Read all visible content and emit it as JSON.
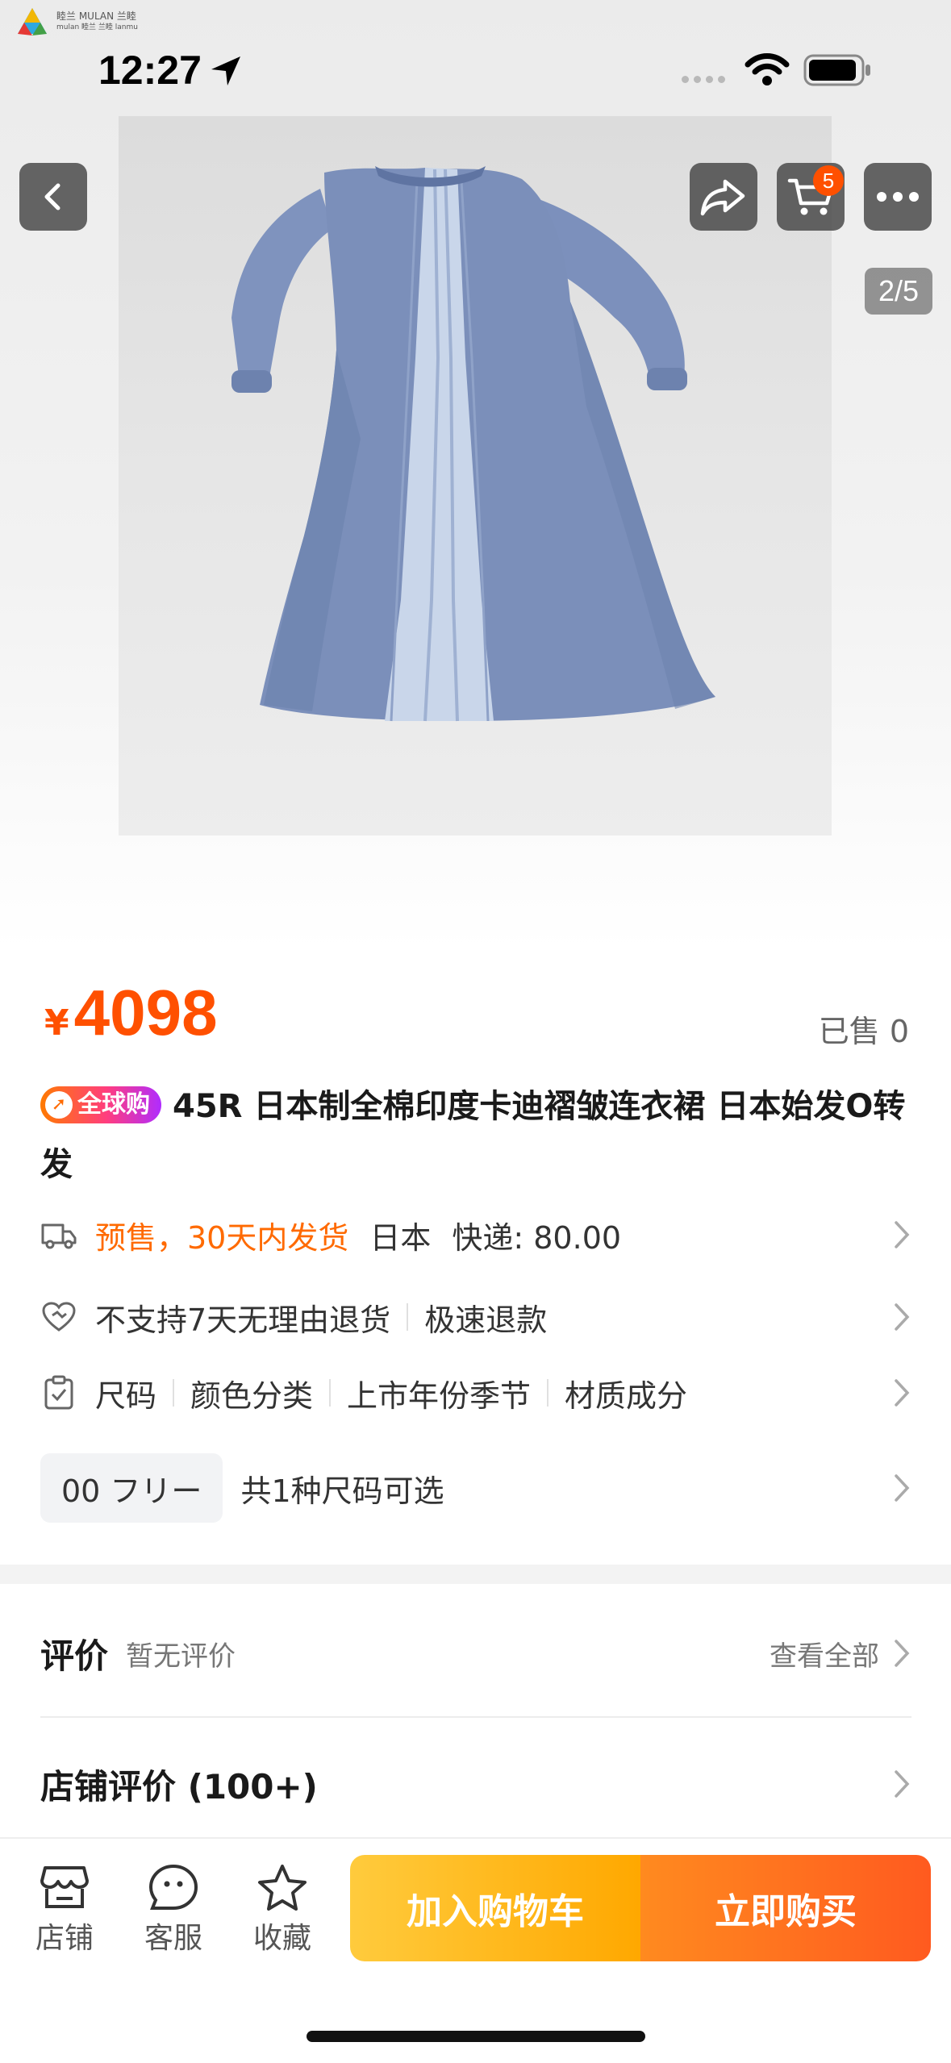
{
  "watermark": {
    "text_line1": "睦兰 MULAN 兰睦",
    "text_line2": "mulan 睦兰 兰睦 lanmu"
  },
  "status": {
    "time": "12:27"
  },
  "hero": {
    "cart_count": "5",
    "page_indicator": "2/5"
  },
  "product": {
    "currency": "¥",
    "price": "4098",
    "sold": "已售 0",
    "tag": "全球购",
    "title": "45R 日本制全棉印度卡迪褶皱连衣裙 日本始发O转发"
  },
  "shipping": {
    "presale": "预售，30天内发货",
    "origin": "日本",
    "express": "快递: 80.00"
  },
  "service": {
    "no_return": "不支持7天无理由退货",
    "refund": "极速退款"
  },
  "params": {
    "size": "尺码",
    "color": "颜色分类",
    "season": "上市年份季节",
    "material": "材质成分"
  },
  "size_select": {
    "chip": "00 フリー",
    "note": "共1种尺码可选"
  },
  "reviews": {
    "title": "评价",
    "empty": "暂无评价",
    "view_all": "查看全部"
  },
  "shop_reviews": {
    "title": "店铺评价 (100+)"
  },
  "bottom": {
    "store": "店铺",
    "service": "客服",
    "favorite": "收藏",
    "add_cart": "加入购物车",
    "buy_now": "立即购买"
  },
  "colors": {
    "accent": "#ff5000",
    "cart_btn": "#ffb300",
    "buy_btn": "#ff6a1f"
  }
}
